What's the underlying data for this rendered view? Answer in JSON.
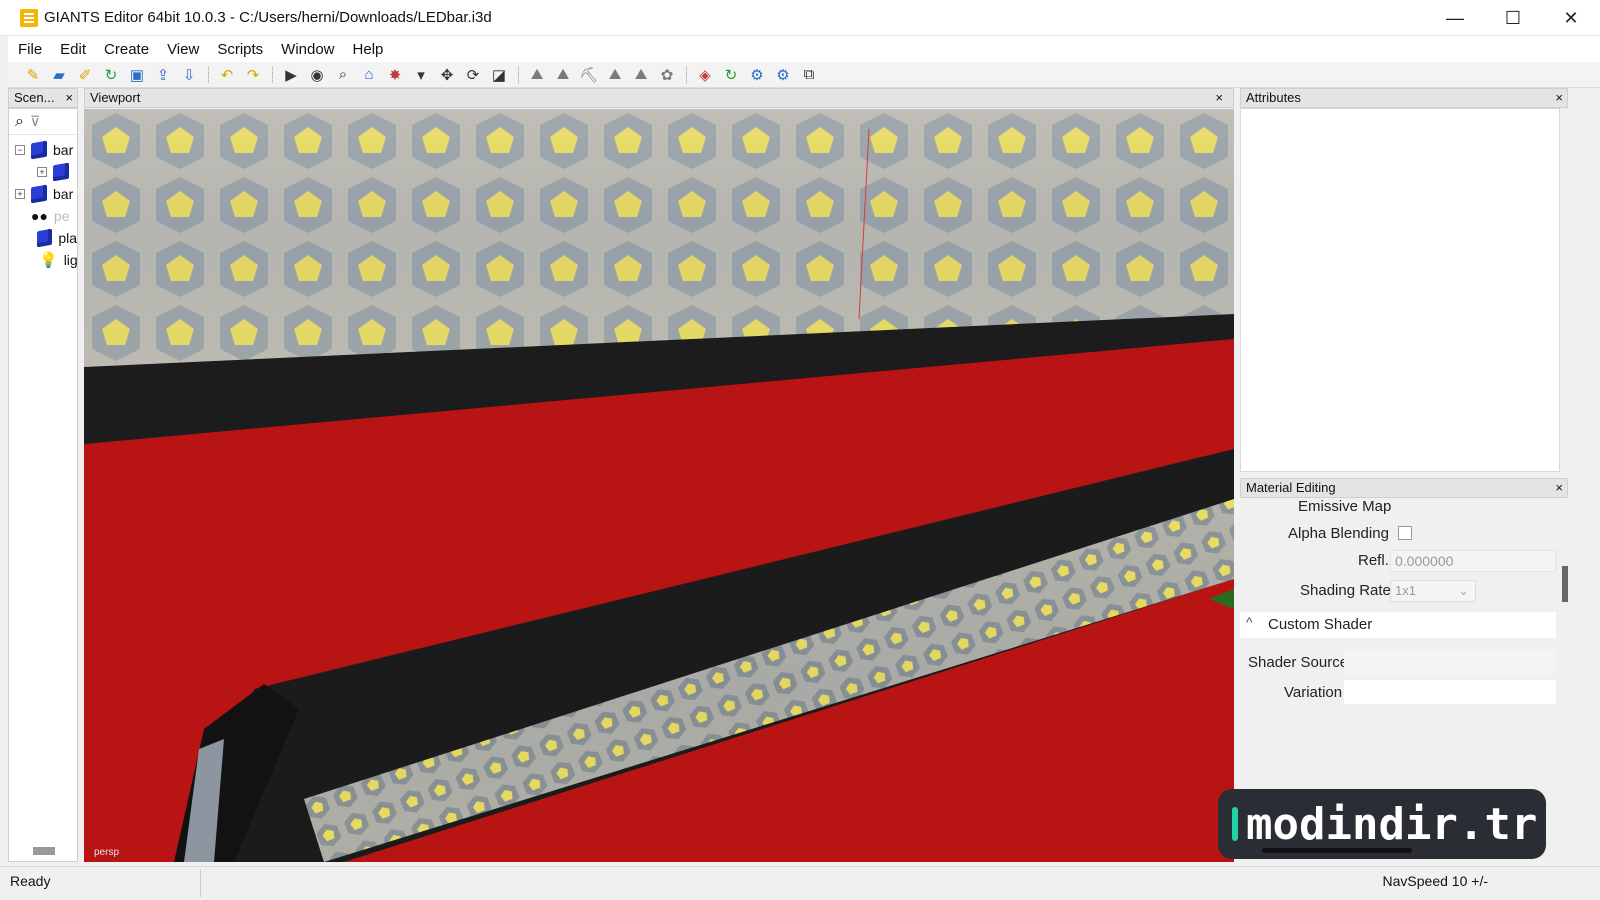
{
  "window": {
    "title": "GIANTS Editor 64bit 10.0.3 - C:/Users/herni/Downloads/LEDbar.i3d",
    "controls": [
      "—",
      "☐",
      "✕"
    ]
  },
  "menu": [
    "File",
    "Edit",
    "Create",
    "View",
    "Scripts",
    "Window",
    "Help"
  ],
  "toolbar_icons": [
    "new-file",
    "open-folder",
    "edit",
    "reload",
    "save",
    "export",
    "import",
    "undo",
    "redo",
    "play",
    "eye",
    "zoom",
    "home",
    "terrain",
    "dropdown",
    "move",
    "rotate",
    "scale",
    "tool1",
    "tool2",
    "tool3",
    "tool4",
    "tool5",
    "tool6",
    "material",
    "refresh",
    "gear1",
    "gear2",
    "copy"
  ],
  "scenegraph": {
    "title": "Scen...",
    "close": "×",
    "items": [
      {
        "label": "bar",
        "type": "cube",
        "expander": "−",
        "level": 0
      },
      {
        "label": "",
        "type": "cube",
        "expander": "+",
        "level": 1
      },
      {
        "label": "bar",
        "type": "cube",
        "expander": "+",
        "level": 0
      },
      {
        "label": "pe",
        "type": "camera",
        "expander": "",
        "level": 0
      },
      {
        "label": "pla",
        "type": "cube",
        "expander": "",
        "level": 0
      },
      {
        "label": "ligh",
        "type": "light",
        "expander": "",
        "level": 0
      }
    ]
  },
  "viewport": {
    "title": "Viewport",
    "close": "×",
    "camera_label": "persp"
  },
  "attributes": {
    "title": "Attributes",
    "close": "×"
  },
  "material_editing": {
    "title": "Material Editing",
    "close": "×",
    "emissive_map": "Emissive Map",
    "alpha_blending": "Alpha Blending",
    "alpha_checked": false,
    "refl_label": "Refl.",
    "refl_value": "0.000000",
    "shading_rate_label": "Shading Rate",
    "shading_rate_value": "1x1",
    "custom_shader": "Custom Shader",
    "shader_source": "Shader Source",
    "variation": "Variation"
  },
  "status": {
    "left": "Ready",
    "right": "NavSpeed 10 +/-"
  },
  "watermark": "modindir.tr",
  "colors": {
    "red_surface": "#b81414",
    "led_yellow": "#f0e04a",
    "bar_black": "#1c1c1c"
  }
}
